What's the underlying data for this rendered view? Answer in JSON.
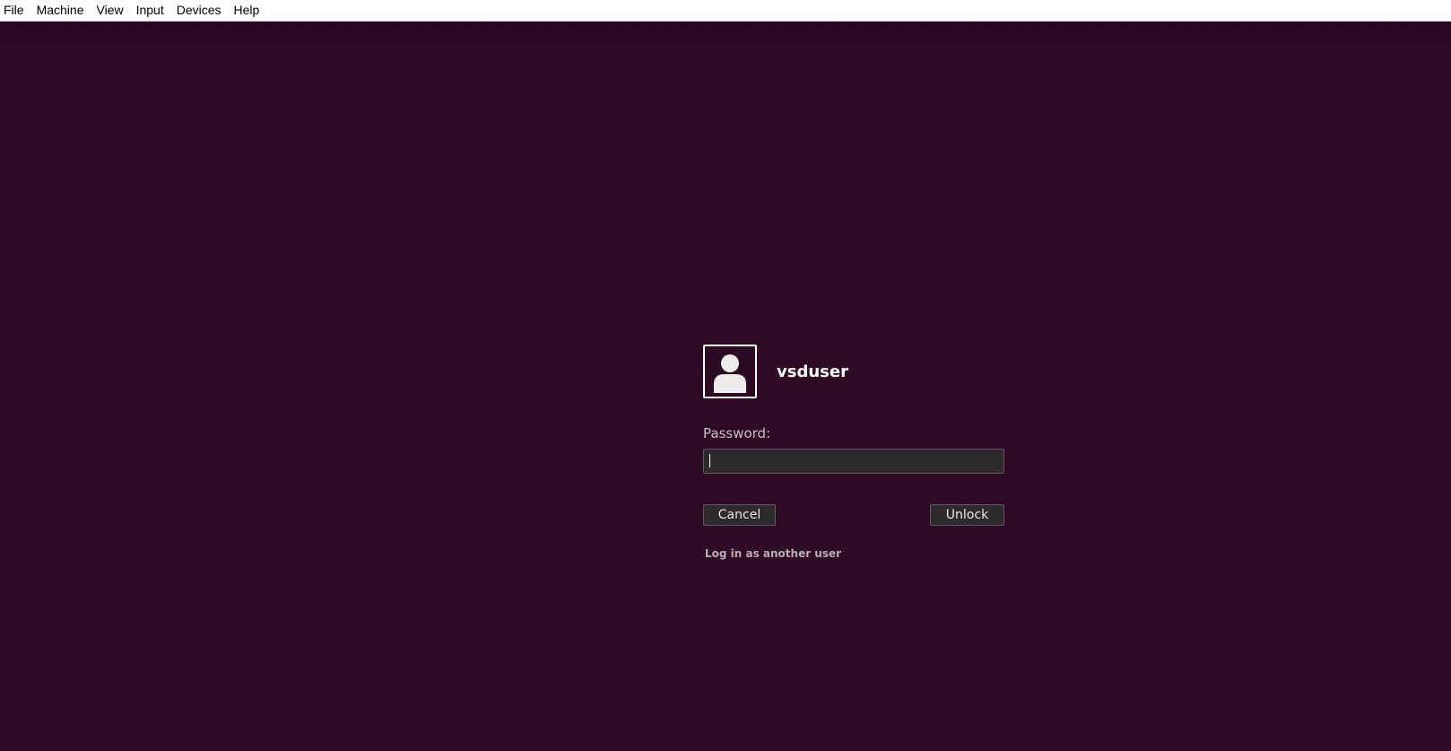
{
  "menubar": {
    "items": [
      "File",
      "Machine",
      "View",
      "Input",
      "Devices",
      "Help"
    ]
  },
  "lockscreen": {
    "username": "vsduser",
    "password_label": "Password:",
    "password_value": "",
    "cancel_label": "Cancel",
    "unlock_label": "Unlock",
    "other_user_label": "Log in as another user"
  },
  "colors": {
    "background": "#2c0a22",
    "menubar": "#ffffff",
    "button": "#2e2b2c",
    "text": "#ffffff"
  },
  "icons": {
    "avatar": "user-silhouette-icon"
  }
}
